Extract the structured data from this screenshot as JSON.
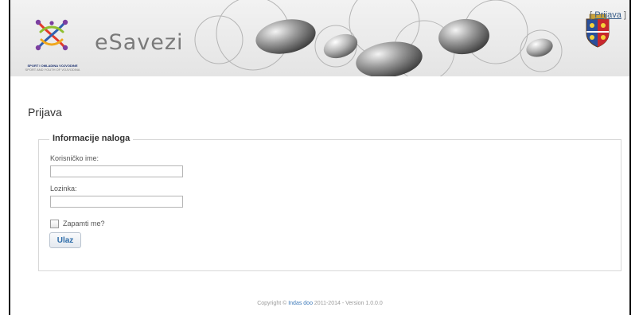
{
  "header": {
    "login_link_open": "[ ",
    "login_link": "Prijava",
    "login_link_close": " ]",
    "brand": "eSavezi",
    "logo_caption": "SPORT I OMLADINA VOJVODINE",
    "logo_caption_sub": "SPORT AND YOUTH OF VOJVODINA"
  },
  "page": {
    "title": "Prijava"
  },
  "form": {
    "legend": "Informacije naloga",
    "username_label": "Korisničko ime:",
    "password_label": "Lozinka:",
    "remember_label": "Zapamti me?",
    "submit_label": "Ulaz"
  },
  "footer": {
    "prefix": "Copyright © ",
    "company": "Indas doo",
    "suffix": " 2011-2014 - Version 1.0.0.0"
  },
  "colors": {
    "link": "#3a5f8a",
    "button_text": "#2a6aa8",
    "header_bg": "#e8e8e8"
  }
}
